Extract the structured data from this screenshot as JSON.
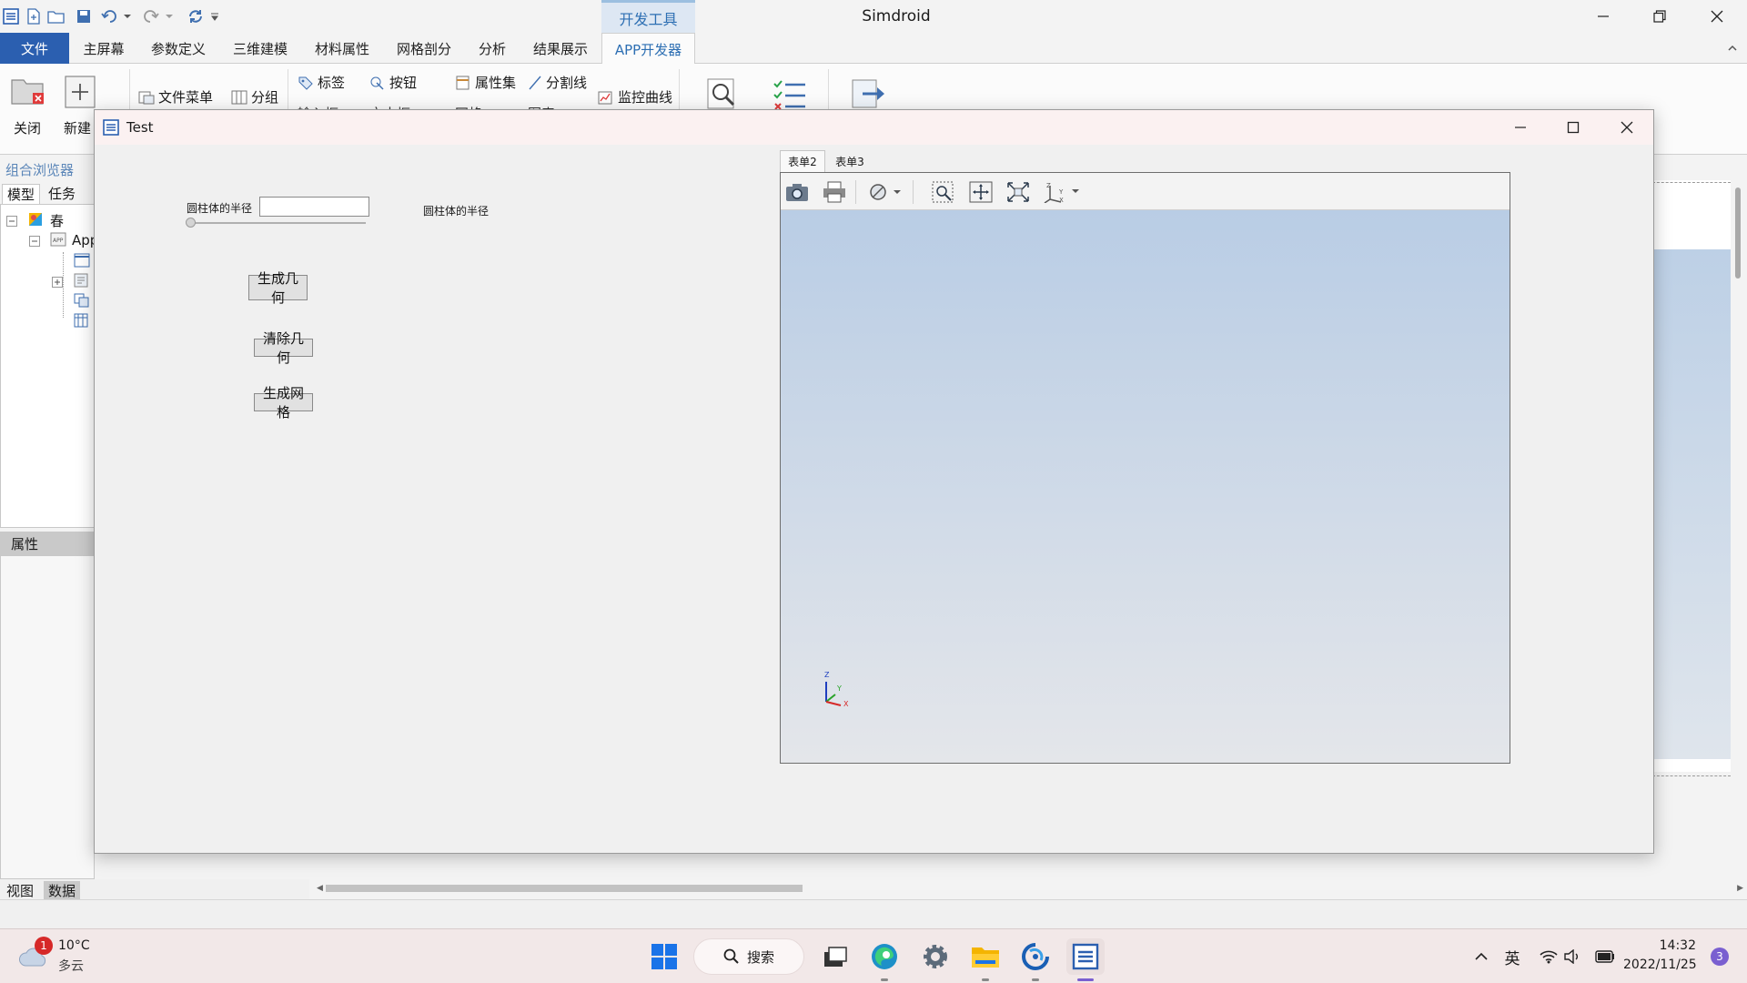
{
  "titlebar": {
    "app_title": "Simdroid",
    "context_tab": "开发工具"
  },
  "ribbon_tabs": {
    "file": "文件",
    "tabs": [
      "主屏幕",
      "参数定义",
      "三维建模",
      "材料属性",
      "网格剖分",
      "分析",
      "结果展示"
    ],
    "active": "APP开发器"
  },
  "ribbon": {
    "close": "关闭",
    "new": "新建",
    "file_menu": "文件菜单",
    "group": "分组",
    "label": "标签",
    "button": "按钮",
    "property_set": "属性集",
    "split_line": "分割线",
    "monitor_curve": "监控曲线",
    "partial_row": [
      "输入框",
      "文本框",
      "网格",
      "图表"
    ]
  },
  "browser": {
    "header": "组合浏览器",
    "tabs": [
      "模型",
      "任务"
    ],
    "tree_root": "春",
    "tree_app": "App"
  },
  "properties": {
    "header": "属性"
  },
  "bottom_tabs": [
    "视图",
    "数据"
  ],
  "dialog": {
    "title": "Test",
    "radius_label": "圆柱体的半径",
    "radius_value": "",
    "radius_label_right": "圆柱体的半径",
    "slider_value": 0,
    "buttons": {
      "generate_geometry": "生成几何",
      "clear_geometry": "清除几何",
      "generate_mesh": "生成网格"
    },
    "form_tabs": [
      "表单2",
      "表单3"
    ],
    "active_form_tab": "表单2",
    "axis_labels": {
      "x": "X",
      "y": "Y",
      "z": "Z"
    }
  },
  "taskbar": {
    "weather_temp": "10°C",
    "weather_desc": "多云",
    "weather_badge": "1",
    "search": "搜索",
    "ime": "英",
    "time": "14:32",
    "date": "2022/11/25",
    "notification_count": "3"
  },
  "colors": {
    "accent": "#2b5fb0",
    "context_tab": "#2d6fb3",
    "viewport_top": "#b9cde5",
    "viewport_bottom": "#e4e6ea"
  }
}
